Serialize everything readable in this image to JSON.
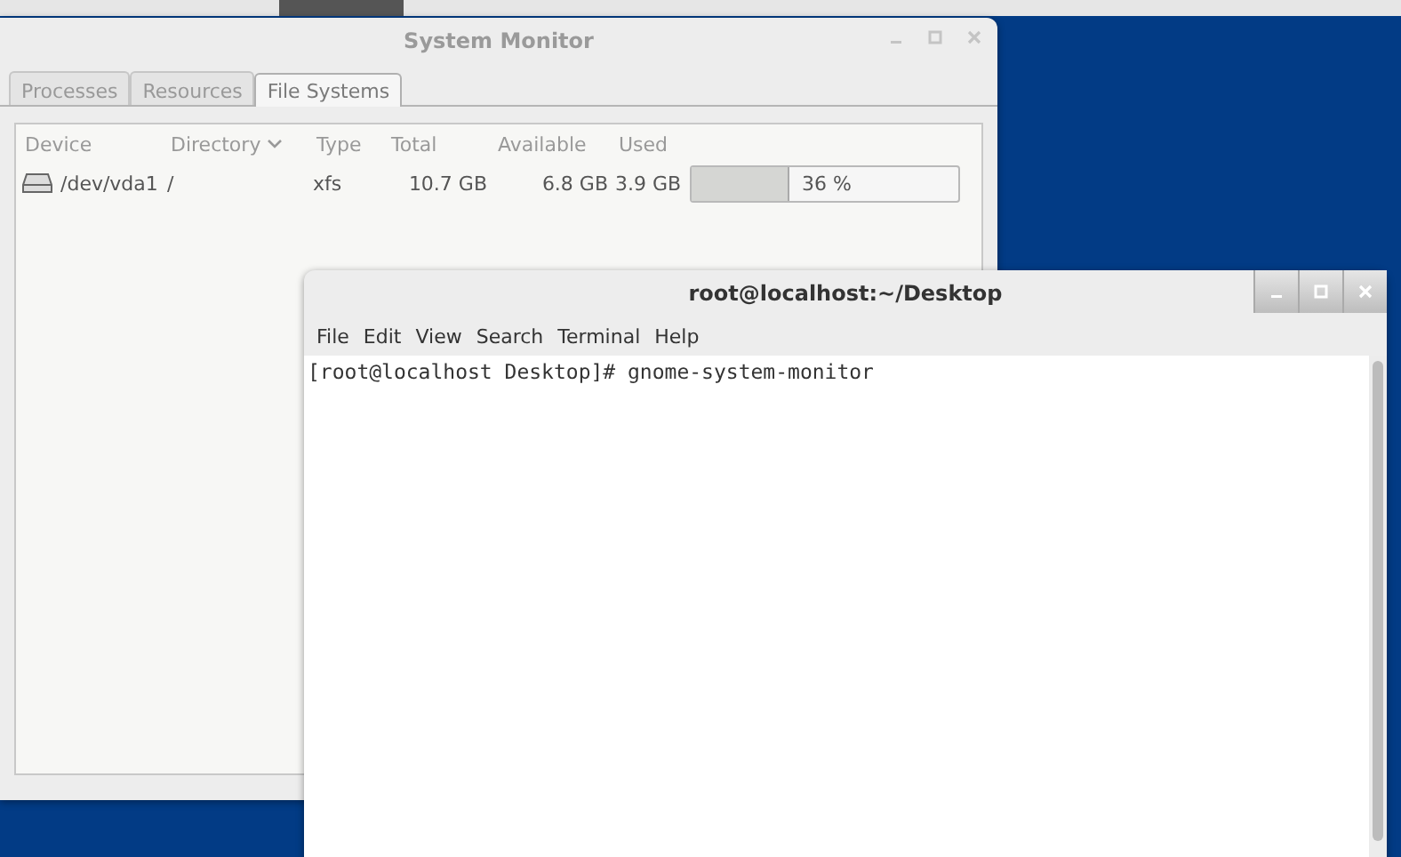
{
  "system_monitor": {
    "title": "System Monitor",
    "tabs": [
      {
        "label": "Processes",
        "selected": false
      },
      {
        "label": "Resources",
        "selected": false
      },
      {
        "label": "File Systems",
        "selected": true
      }
    ],
    "table": {
      "columns": [
        {
          "label": "Device",
          "sorted": false
        },
        {
          "label": "Directory",
          "sorted": true
        },
        {
          "label": "Type",
          "sorted": false
        },
        {
          "label": "Total",
          "sorted": false
        },
        {
          "label": "Available",
          "sorted": false
        },
        {
          "label": "Used",
          "sorted": false
        }
      ],
      "rows": [
        {
          "device": "/dev/vda1",
          "directory": "/",
          "type": "xfs",
          "total": "10.7 GB",
          "available": "6.8 GB",
          "used": "3.9 GB",
          "level": 0.36,
          "percent": "36 %"
        }
      ]
    }
  },
  "terminal": {
    "title": "root@localhost:~/Desktop",
    "menu": [
      "File",
      "Edit",
      "View",
      "Search",
      "Terminal",
      "Help"
    ],
    "lines": [
      "[root@localhost Desktop]# gnome-system-monitor"
    ]
  }
}
